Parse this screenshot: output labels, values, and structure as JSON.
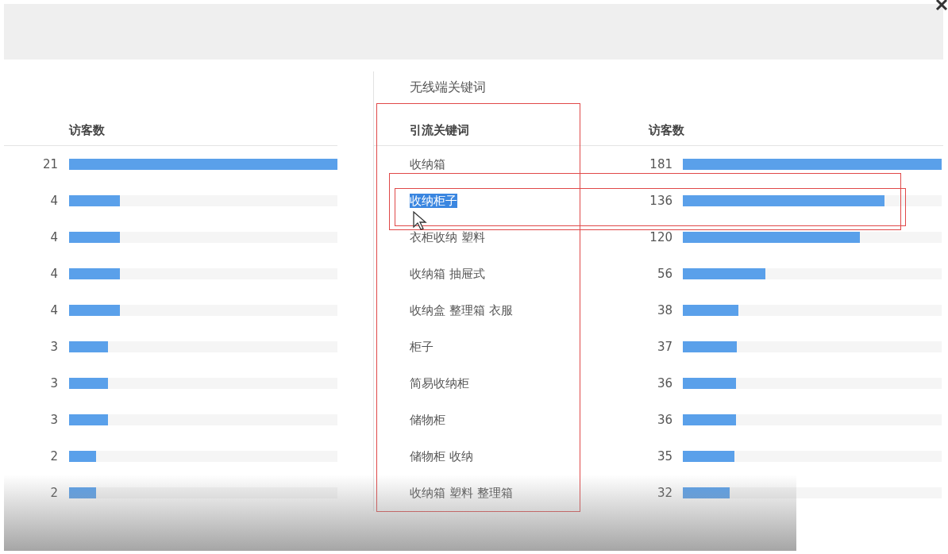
{
  "left_panel": {
    "header": "访客数",
    "rows": [
      {
        "value": "21",
        "level": 1
      },
      {
        "value": "4",
        "level": 0.19
      },
      {
        "value": "4",
        "level": 0.19
      },
      {
        "value": "4",
        "level": 0.19
      },
      {
        "value": "4",
        "level": 0.19
      },
      {
        "value": "3",
        "level": 0.145
      },
      {
        "value": "3",
        "level": 0.145
      },
      {
        "value": "3",
        "level": 0.145
      },
      {
        "value": "2",
        "level": 0.1
      },
      {
        "value": "2",
        "level": 0.1
      }
    ]
  },
  "right_panel": {
    "title": "无线端关键词",
    "columns": [
      "引流关键词",
      "访客数"
    ],
    "rows": [
      {
        "keyword": "收纳箱",
        "value": "181",
        "level": 1,
        "selected": false
      },
      {
        "keyword": "收纳柜子",
        "value": "136",
        "level": 0.78,
        "selected": true
      },
      {
        "keyword": "衣柜收纳 塑料",
        "value": "120",
        "level": 0.685,
        "selected": false
      },
      {
        "keyword": "收纳箱 抽屉式",
        "value": "56",
        "level": 0.32,
        "selected": false
      },
      {
        "keyword": "收纳盒 整理箱 衣服",
        "value": "38",
        "level": 0.215,
        "selected": false
      },
      {
        "keyword": "柜子",
        "value": "37",
        "level": 0.21,
        "selected": false
      },
      {
        "keyword": "简易收纳柜",
        "value": "36",
        "level": 0.205,
        "selected": false
      },
      {
        "keyword": "储物柜",
        "value": "36",
        "level": 0.205,
        "selected": false
      },
      {
        "keyword": "储物柜 收纳",
        "value": "35",
        "level": 0.2,
        "selected": false
      },
      {
        "keyword": "收纳箱 塑料 整理箱",
        "value": "32",
        "level": 0.18,
        "selected": false
      }
    ]
  }
}
